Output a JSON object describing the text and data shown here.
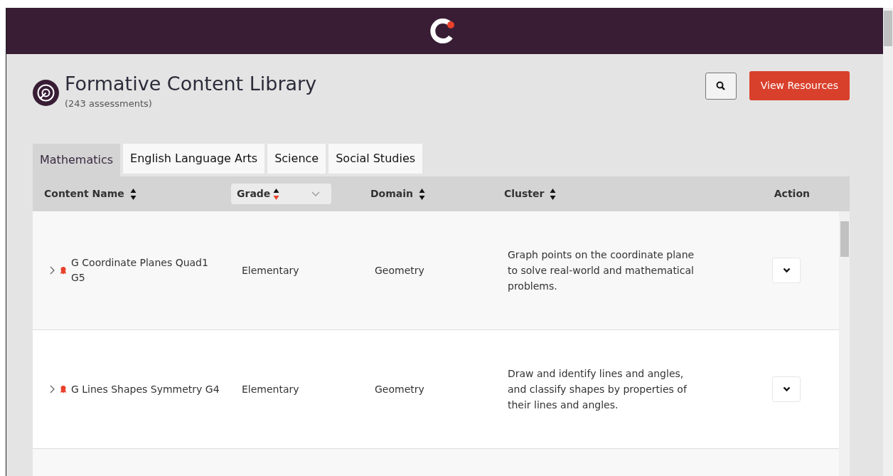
{
  "page": {
    "title": "Formative Content Library",
    "subtitle": "(243 assessments)"
  },
  "toolbar": {
    "primary_button": "View Resources"
  },
  "tabs": [
    {
      "label": "Mathematics",
      "selected": true
    },
    {
      "label": "English Language Arts",
      "selected": false
    },
    {
      "label": "Science",
      "selected": false
    },
    {
      "label": "Social Studies",
      "selected": false
    }
  ],
  "table": {
    "columns": [
      {
        "label": "Content Name",
        "kind": "sortable",
        "sorted_descending": false
      },
      {
        "label": "Grade",
        "kind": "dropdown",
        "sorted_descending": true
      },
      {
        "label": "Domain",
        "kind": "sortable",
        "sorted_descending": false
      },
      {
        "label": "Cluster",
        "kind": "sortable",
        "sorted_descending": false
      },
      {
        "label": "Action",
        "kind": "plain"
      }
    ],
    "rows": [
      {
        "expanded": false,
        "content_name": "G Coordinate Planes Quad1 G5",
        "grade": "Elementary",
        "domain": "Geometry",
        "cluster": "Graph points on the coordinate plane to solve real-world and mathematical problems."
      },
      {
        "expanded": false,
        "content_name": "G Lines Shapes Symmetry G4",
        "grade": "Elementary",
        "domain": "Geometry",
        "cluster": "Draw and identify lines and angles, and classify shapes by properties of their lines and angles."
      }
    ]
  }
}
